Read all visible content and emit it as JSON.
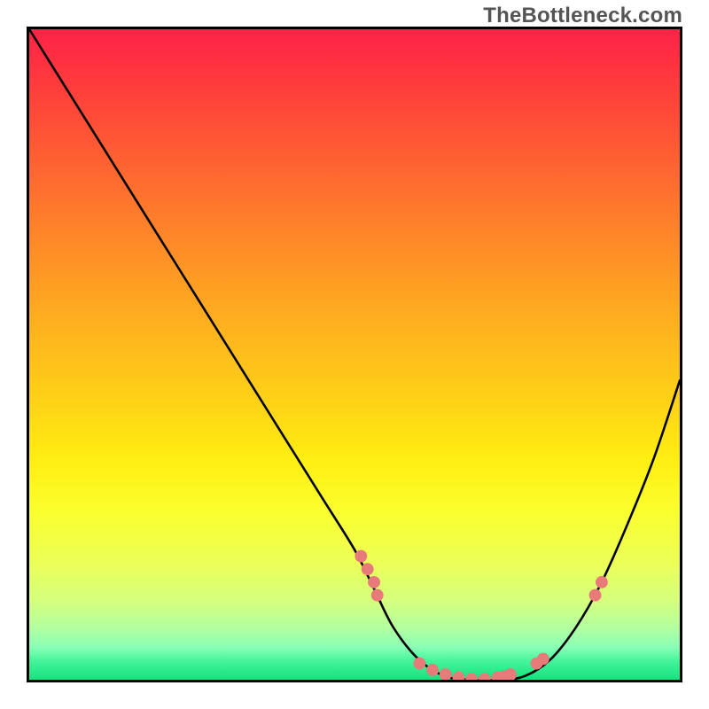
{
  "watermark": "TheBottleneck.com",
  "chart_data": {
    "type": "line",
    "title": "",
    "xlabel": "",
    "ylabel": "",
    "xlim": [
      0,
      100
    ],
    "ylim": [
      0,
      100
    ],
    "grid": false,
    "legend": false,
    "background_gradient": {
      "orientation": "vertical",
      "stops": [
        {
          "pos": 0.0,
          "color": "#ff2247"
        },
        {
          "pos": 0.18,
          "color": "#ff5a34"
        },
        {
          "pos": 0.38,
          "color": "#ff9a24"
        },
        {
          "pos": 0.58,
          "color": "#ffd416"
        },
        {
          "pos": 0.74,
          "color": "#fbff2e"
        },
        {
          "pos": 0.88,
          "color": "#d4ff7e"
        },
        {
          "pos": 0.95,
          "color": "#8affb6"
        },
        {
          "pos": 1.0,
          "color": "#12e37f"
        }
      ]
    },
    "series": [
      {
        "name": "bottleneck-curve",
        "color": "#000000",
        "x": [
          0,
          5,
          10,
          15,
          20,
          25,
          30,
          35,
          40,
          45,
          50,
          53,
          56,
          60,
          64,
          68,
          72,
          76,
          80,
          84,
          88,
          92,
          96,
          100
        ],
        "y": [
          100,
          92,
          84,
          76,
          68,
          60,
          52,
          44,
          36,
          28,
          20,
          14,
          8,
          3,
          0.5,
          0,
          0,
          0.5,
          3,
          8,
          15,
          24,
          34,
          46
        ]
      }
    ],
    "markers": {
      "name": "highlight-points",
      "shape": "circle",
      "color": "#e87a7a",
      "radius_px": 7,
      "x": [
        51,
        52,
        53,
        53.5,
        60,
        62,
        64,
        66,
        68,
        70,
        72,
        73,
        74,
        78,
        79,
        87,
        88
      ],
      "y": [
        19,
        17,
        15,
        13,
        2.5,
        1.5,
        0.8,
        0.3,
        0.1,
        0.1,
        0.3,
        0.5,
        0.8,
        2.5,
        3.2,
        13,
        15
      ]
    }
  }
}
